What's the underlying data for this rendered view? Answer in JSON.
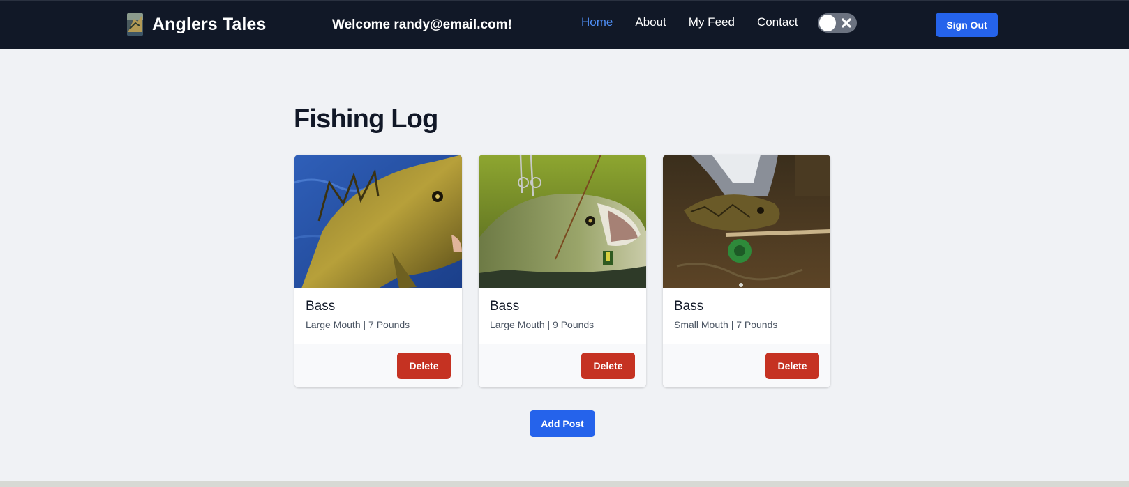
{
  "navbar": {
    "brand_name": "Anglers Tales",
    "welcome_text": "Welcome randy@email.com!",
    "links": [
      {
        "label": "Home",
        "active": true
      },
      {
        "label": "About",
        "active": false
      },
      {
        "label": "My Feed",
        "active": false
      },
      {
        "label": "Contact",
        "active": false
      }
    ],
    "theme_toggle_on": false,
    "sign_out_label": "Sign Out"
  },
  "main": {
    "title": "Fishing Log",
    "cards": [
      {
        "title": "Bass",
        "subtitle": "Large Mouth | 7 Pounds",
        "delete_label": "Delete"
      },
      {
        "title": "Bass",
        "subtitle": "Large Mouth | 9 Pounds",
        "delete_label": "Delete"
      },
      {
        "title": "Bass",
        "subtitle": "Small Mouth | 7 Pounds",
        "delete_label": "Delete"
      }
    ],
    "add_post_label": "Add Post"
  },
  "colors": {
    "navbar_bg": "#111827",
    "active_link": "#4f8ff7",
    "primary_button": "#2563eb",
    "delete_button": "#c53222",
    "page_bg": "#f0f2f5"
  },
  "icons": {
    "logo": "fish-photo-logo",
    "toggle": "close-x-icon"
  }
}
